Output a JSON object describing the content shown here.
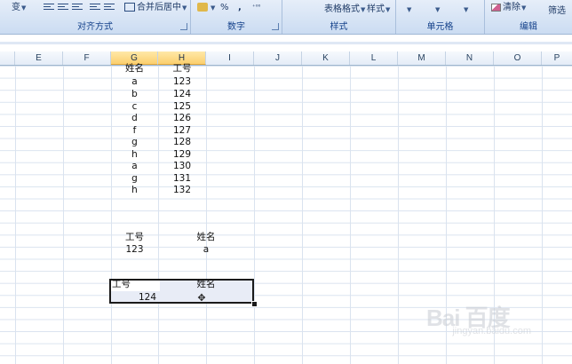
{
  "ribbon": {
    "groups": [
      {
        "title": "对齐方式"
      },
      {
        "title": "数字"
      },
      {
        "title": "样式"
      },
      {
        "title": "单元格"
      },
      {
        "title": "编辑"
      }
    ],
    "merge_center_label": "合并后居中",
    "percent_label": "%",
    "comma_label": ",",
    "table_format_label": "表格格式",
    "cell_style_label": "样式",
    "clear_label": "清除",
    "filter_label": "筛选",
    "wrap_label": "变"
  },
  "columns": [
    "E",
    "F",
    "G",
    "H",
    "I",
    "J",
    "K",
    "L",
    "M",
    "N",
    "O",
    "P"
  ],
  "active_columns": [
    "G",
    "H"
  ],
  "table1": {
    "header_name": "姓名",
    "header_id": "工号",
    "rows": [
      {
        "name": "a",
        "id": "123"
      },
      {
        "name": "b",
        "id": "124"
      },
      {
        "name": "c",
        "id": "125"
      },
      {
        "name": "d",
        "id": "126"
      },
      {
        "name": "f",
        "id": "127"
      },
      {
        "name": "g",
        "id": "128"
      },
      {
        "name": "h",
        "id": "129"
      },
      {
        "name": "a",
        "id": "130"
      },
      {
        "name": "g",
        "id": "131"
      },
      {
        "name": "h",
        "id": "132"
      }
    ]
  },
  "lookup1": {
    "header_id": "工号",
    "header_name": "姓名",
    "id_value": "123",
    "name_value": "a"
  },
  "lookup2": {
    "header_id": "工号",
    "header_name": "姓名",
    "id_value": "124"
  },
  "watermark": {
    "main": "Bai 百度",
    "sub": "jingyan.baidu.com"
  },
  "colors": {
    "ribbon_bg": "#d7e4f5",
    "ribbon_text": "#15428b",
    "active_header": "#fbcf6e",
    "grid_line": "#dae3ef",
    "selection_border": "#1b1b1b"
  }
}
